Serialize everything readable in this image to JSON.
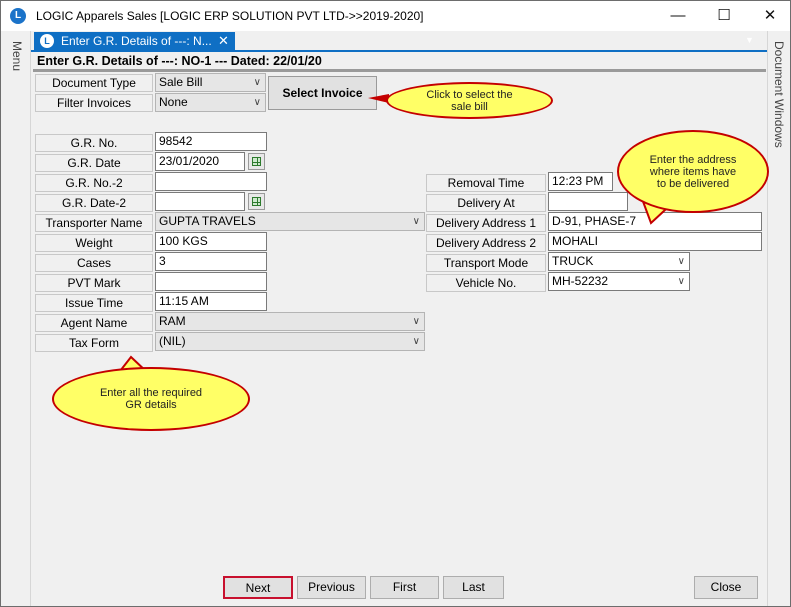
{
  "window": {
    "title": "LOGIC Apparels Sales  [LOGIC ERP SOLUTION PVT LTD->>2019-2020]",
    "icon": "logic-app-icon"
  },
  "sidebar": {
    "left_label": "Menu",
    "right_label": "Document Windows"
  },
  "doc_tab": {
    "label": "Enter G.R. Details of ---:  N..."
  },
  "form_header": "Enter G.R. Details of ---:  NO-1  --- Dated: 22/01/20",
  "top_fields": {
    "document_type": {
      "label": "Document Type",
      "value": "Sale Bill"
    },
    "filter_invoices": {
      "label": "Filter Invoices",
      "value": "None"
    },
    "select_invoice_label": "Select Invoice"
  },
  "left_fields": {
    "gr_no": {
      "label": "G.R. No.",
      "value": "98542"
    },
    "gr_date": {
      "label": "G.R. Date",
      "value": "23/01/2020"
    },
    "gr_no_2": {
      "label": "G.R. No.-2",
      "value": ""
    },
    "gr_date_2": {
      "label": "G.R. Date-2",
      "value": ""
    },
    "transporter_name": {
      "label": "Transporter Name",
      "value": "GUPTA TRAVELS"
    },
    "weight": {
      "label": "Weight",
      "value": "100 KGS"
    },
    "cases": {
      "label": "Cases",
      "value": "3"
    },
    "pvt_mark": {
      "label": "PVT Mark",
      "value": ""
    },
    "issue_time": {
      "label": "Issue Time",
      "value": "11:15 AM"
    },
    "agent_name": {
      "label": "Agent Name",
      "value": "RAM"
    },
    "tax_form": {
      "label": "Tax Form",
      "value": "(NIL)"
    }
  },
  "right_fields": {
    "removal_time": {
      "label": "Removal Time",
      "value": "12:23 PM"
    },
    "delivery_at": {
      "label": "Delivery At",
      "value": ""
    },
    "delivery_address_1": {
      "label": "Delivery Address 1",
      "value": "D-91, PHASE-7"
    },
    "delivery_address_2": {
      "label": "Delivery Address 2",
      "value": "MOHALI"
    },
    "transport_mode": {
      "label": "Transport Mode",
      "value": "TRUCK"
    },
    "vehicle_no": {
      "label": "Vehicle No.",
      "value": "MH-52232"
    }
  },
  "callouts": {
    "select_invoice": {
      "line1": "Click  to  select  the",
      "line2": "sale  bill"
    },
    "address": {
      "line1": "Enter  the  address",
      "line2": "where  items  have",
      "line3": "to  be  delivered"
    },
    "gr_details": {
      "line1": "Enter  all  the  required",
      "line2": "GR  details"
    }
  },
  "buttons": {
    "next": "Next",
    "previous": "Previous",
    "first": "First",
    "last": "Last",
    "close": "Close"
  },
  "colors": {
    "accent": "#0f6fc4",
    "callout_fill": "#ffff66",
    "callout_border": "#c40000"
  }
}
